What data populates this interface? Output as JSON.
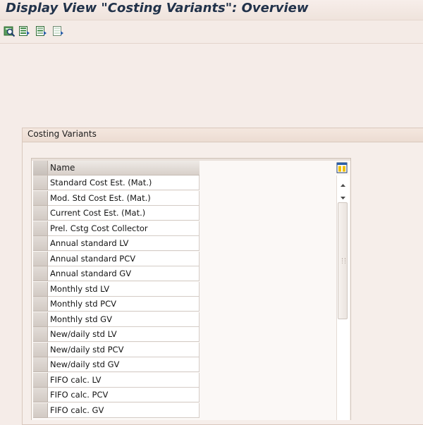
{
  "window": {
    "title": "Display View \"Costing Variants\": Overview"
  },
  "toolbar": {
    "buttons": [
      {
        "icon": "find-icon"
      },
      {
        "icon": "select-all-icon"
      },
      {
        "icon": "select-block-icon"
      },
      {
        "icon": "deselect-all-icon"
      }
    ]
  },
  "group": {
    "title": "Costing Variants"
  },
  "table": {
    "column_header": "Name",
    "rows": [
      "Standard Cost Est. (Mat.)",
      "Mod. Std Cost Est. (Mat.)",
      "Current Cost Est. (Mat.)",
      "Prel. Cstg Cost Collector",
      "Annual standard LV",
      "Annual standard PCV",
      "Annual standard GV",
      "Monthly std LV",
      "Monthly std PCV",
      "Monthly std GV",
      "New/daily std LV",
      "New/daily std PCV",
      "New/daily std GV",
      "FIFO calc. LV",
      "FIFO calc. PCV",
      "FIFO calc. GV"
    ]
  },
  "colors": {
    "title_text": "#21324a",
    "background": "#f5ece8",
    "accent_icon": "#2f7d3a"
  }
}
